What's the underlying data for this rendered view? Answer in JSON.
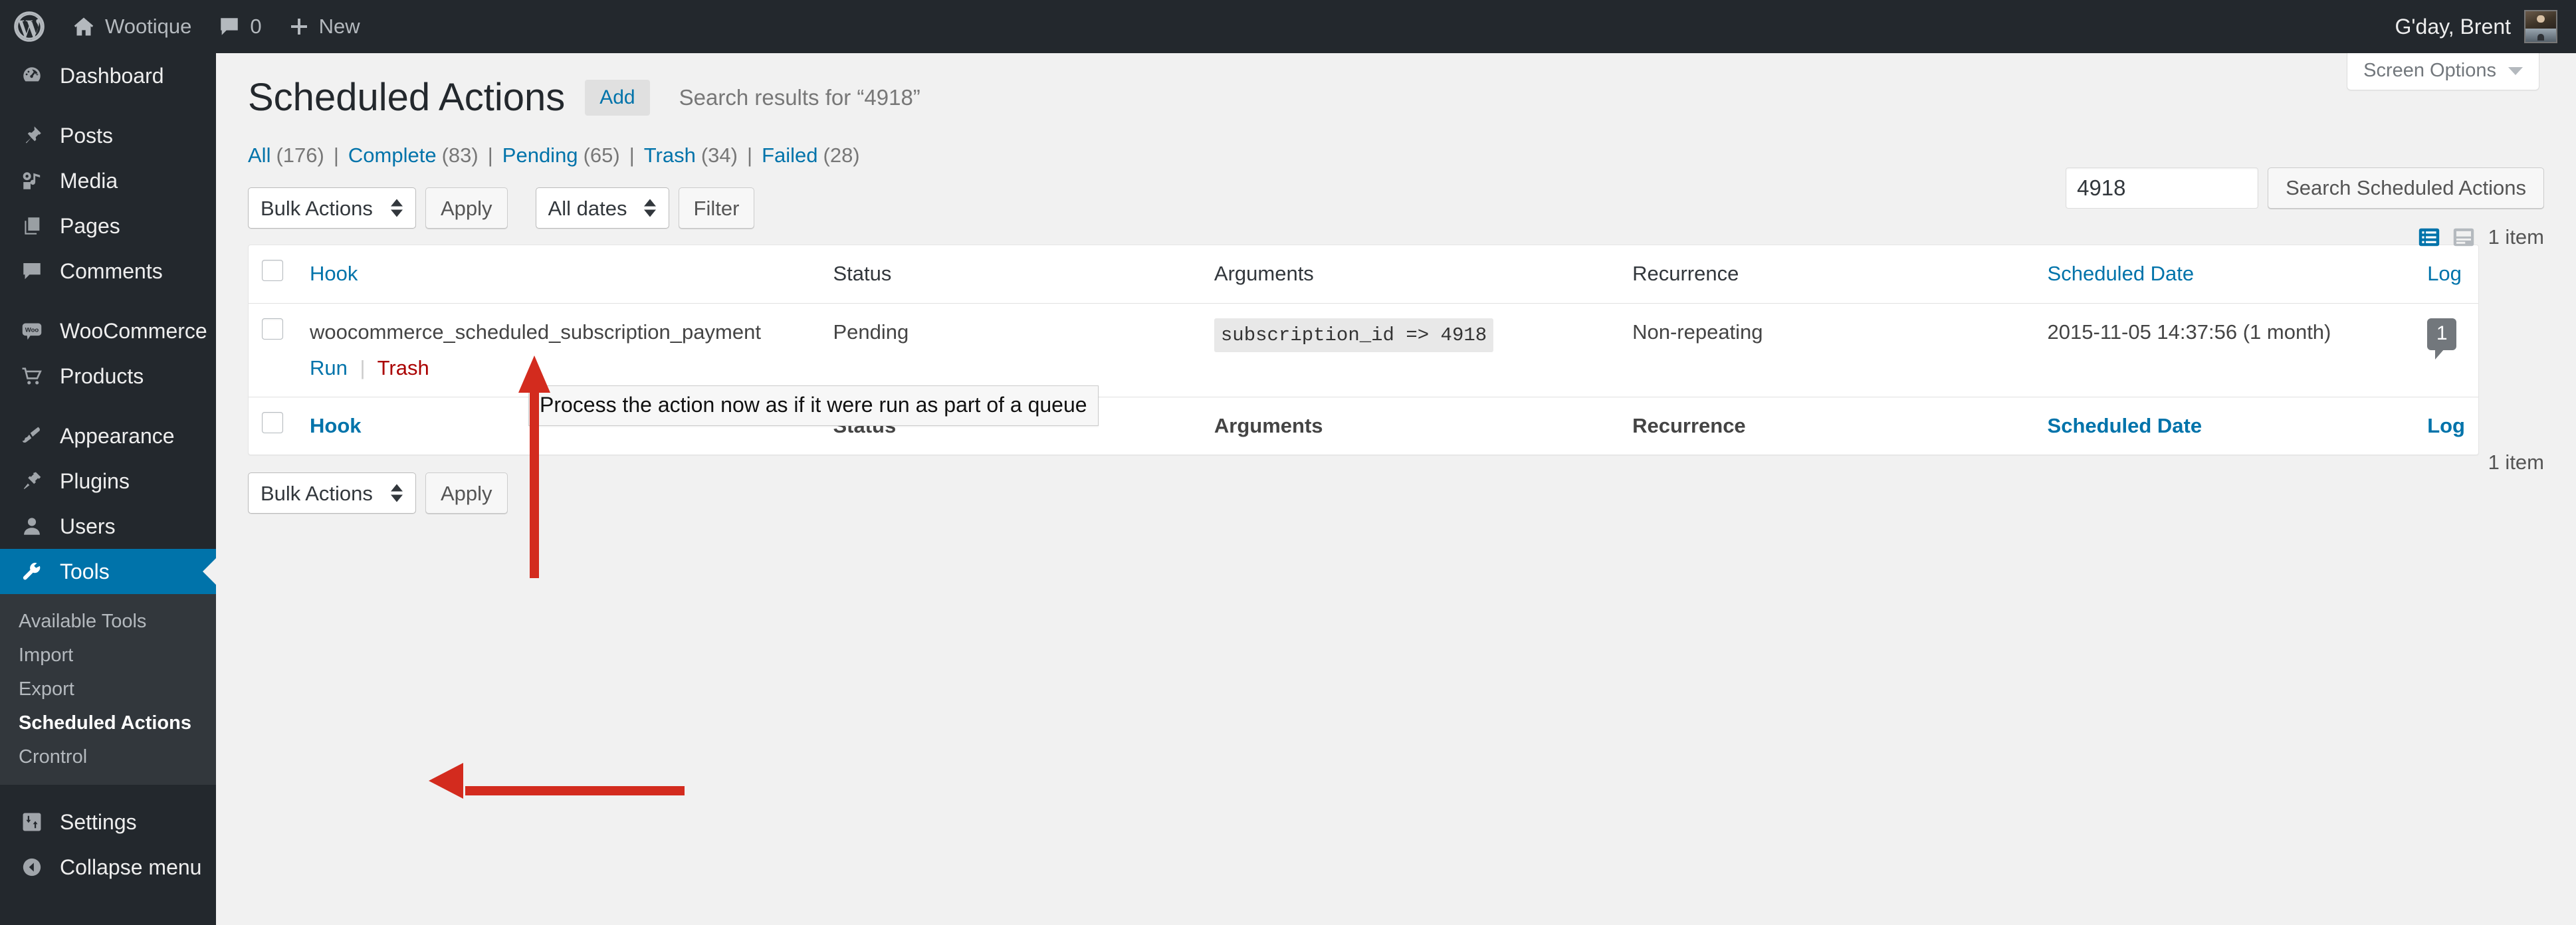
{
  "adminbar": {
    "logo_icon": "wordpress-logo-icon",
    "site_name": "Wootique",
    "home_icon": "home-icon",
    "comment_icon": "comment-bubble-icon",
    "comment_count": "0",
    "plus_icon": "plus-icon",
    "new_label": "New",
    "greeting": "G'day, Brent",
    "avatar_icon": "user-avatar"
  },
  "sidebar": {
    "items": [
      {
        "label": "Dashboard",
        "icon": "dashboard-icon",
        "active": false
      },
      {
        "label": "Posts",
        "icon": "pin-icon",
        "active": false
      },
      {
        "label": "Media",
        "icon": "media-icon",
        "active": false
      },
      {
        "label": "Pages",
        "icon": "pages-icon",
        "active": false
      },
      {
        "label": "Comments",
        "icon": "comment-bubble-icon",
        "active": false
      },
      {
        "label": "WooCommerce",
        "icon": "woocommerce-icon",
        "active": false
      },
      {
        "label": "Products",
        "icon": "cart-icon",
        "active": false
      },
      {
        "label": "Appearance",
        "icon": "paintbrush-icon",
        "active": false
      },
      {
        "label": "Plugins",
        "icon": "plug-icon",
        "active": false
      },
      {
        "label": "Users",
        "icon": "user-icon",
        "active": false
      },
      {
        "label": "Tools",
        "icon": "wrench-icon",
        "active": true
      }
    ],
    "submenu": [
      {
        "label": "Available Tools",
        "current": false
      },
      {
        "label": "Import",
        "current": false
      },
      {
        "label": "Export",
        "current": false
      },
      {
        "label": "Scheduled Actions",
        "current": true
      },
      {
        "label": "Crontrol",
        "current": false
      }
    ],
    "settings": {
      "label": "Settings",
      "icon": "settings-icon"
    },
    "collapse": {
      "label": "Collapse menu",
      "icon": "collapse-arrow-icon"
    },
    "active_color": "#0073aa"
  },
  "screen_meta": {
    "screen_options_label": "Screen Options",
    "caret_icon": "chevron-down-icon"
  },
  "header": {
    "title": "Scheduled Actions",
    "add_button": "Add",
    "search_subtitle": "Search results for “4918”"
  },
  "views": [
    {
      "label": "All",
      "count": "(176)"
    },
    {
      "label": "Complete",
      "count": "(83)"
    },
    {
      "label": "Pending",
      "count": "(65)"
    },
    {
      "label": "Trash",
      "count": "(34)"
    },
    {
      "label": "Failed",
      "count": "(28)"
    }
  ],
  "toolbar": {
    "bulk_actions_label": "Bulk Actions",
    "apply_label": "Apply",
    "dates_label": "All dates",
    "filter_label": "Filter"
  },
  "search": {
    "value": "4918",
    "submit_label": "Search Scheduled Actions",
    "list_view_icon": "list-view-icon",
    "excerpt_view_icon": "excerpt-view-icon"
  },
  "counts": {
    "top_items": "1 item",
    "bottom_items": "1 item"
  },
  "table": {
    "columns": {
      "hook": "Hook",
      "status": "Status",
      "arguments": "Arguments",
      "recurrence": "Recurrence",
      "scheduled_date": "Scheduled Date",
      "log": "Log"
    },
    "rows": [
      {
        "hook": "woocommerce_scheduled_subscription_payment",
        "run_label": "Run",
        "trash_label": "Trash",
        "status": "Pending",
        "arguments": "subscription_id => 4918",
        "recurrence": "Non-repeating",
        "scheduled_date": "2015-11-05 14:37:56 (1 month)",
        "log_count": "1"
      }
    ]
  },
  "tooltip": {
    "text": "Process the action now as if it were run as part of a queue"
  },
  "annotations": {
    "arrow_color": "#d32b1e",
    "arrow_to_run": "arrow-pointing-to-run-link",
    "arrow_to_menu": "arrow-pointing-to-scheduled-actions-menu"
  }
}
